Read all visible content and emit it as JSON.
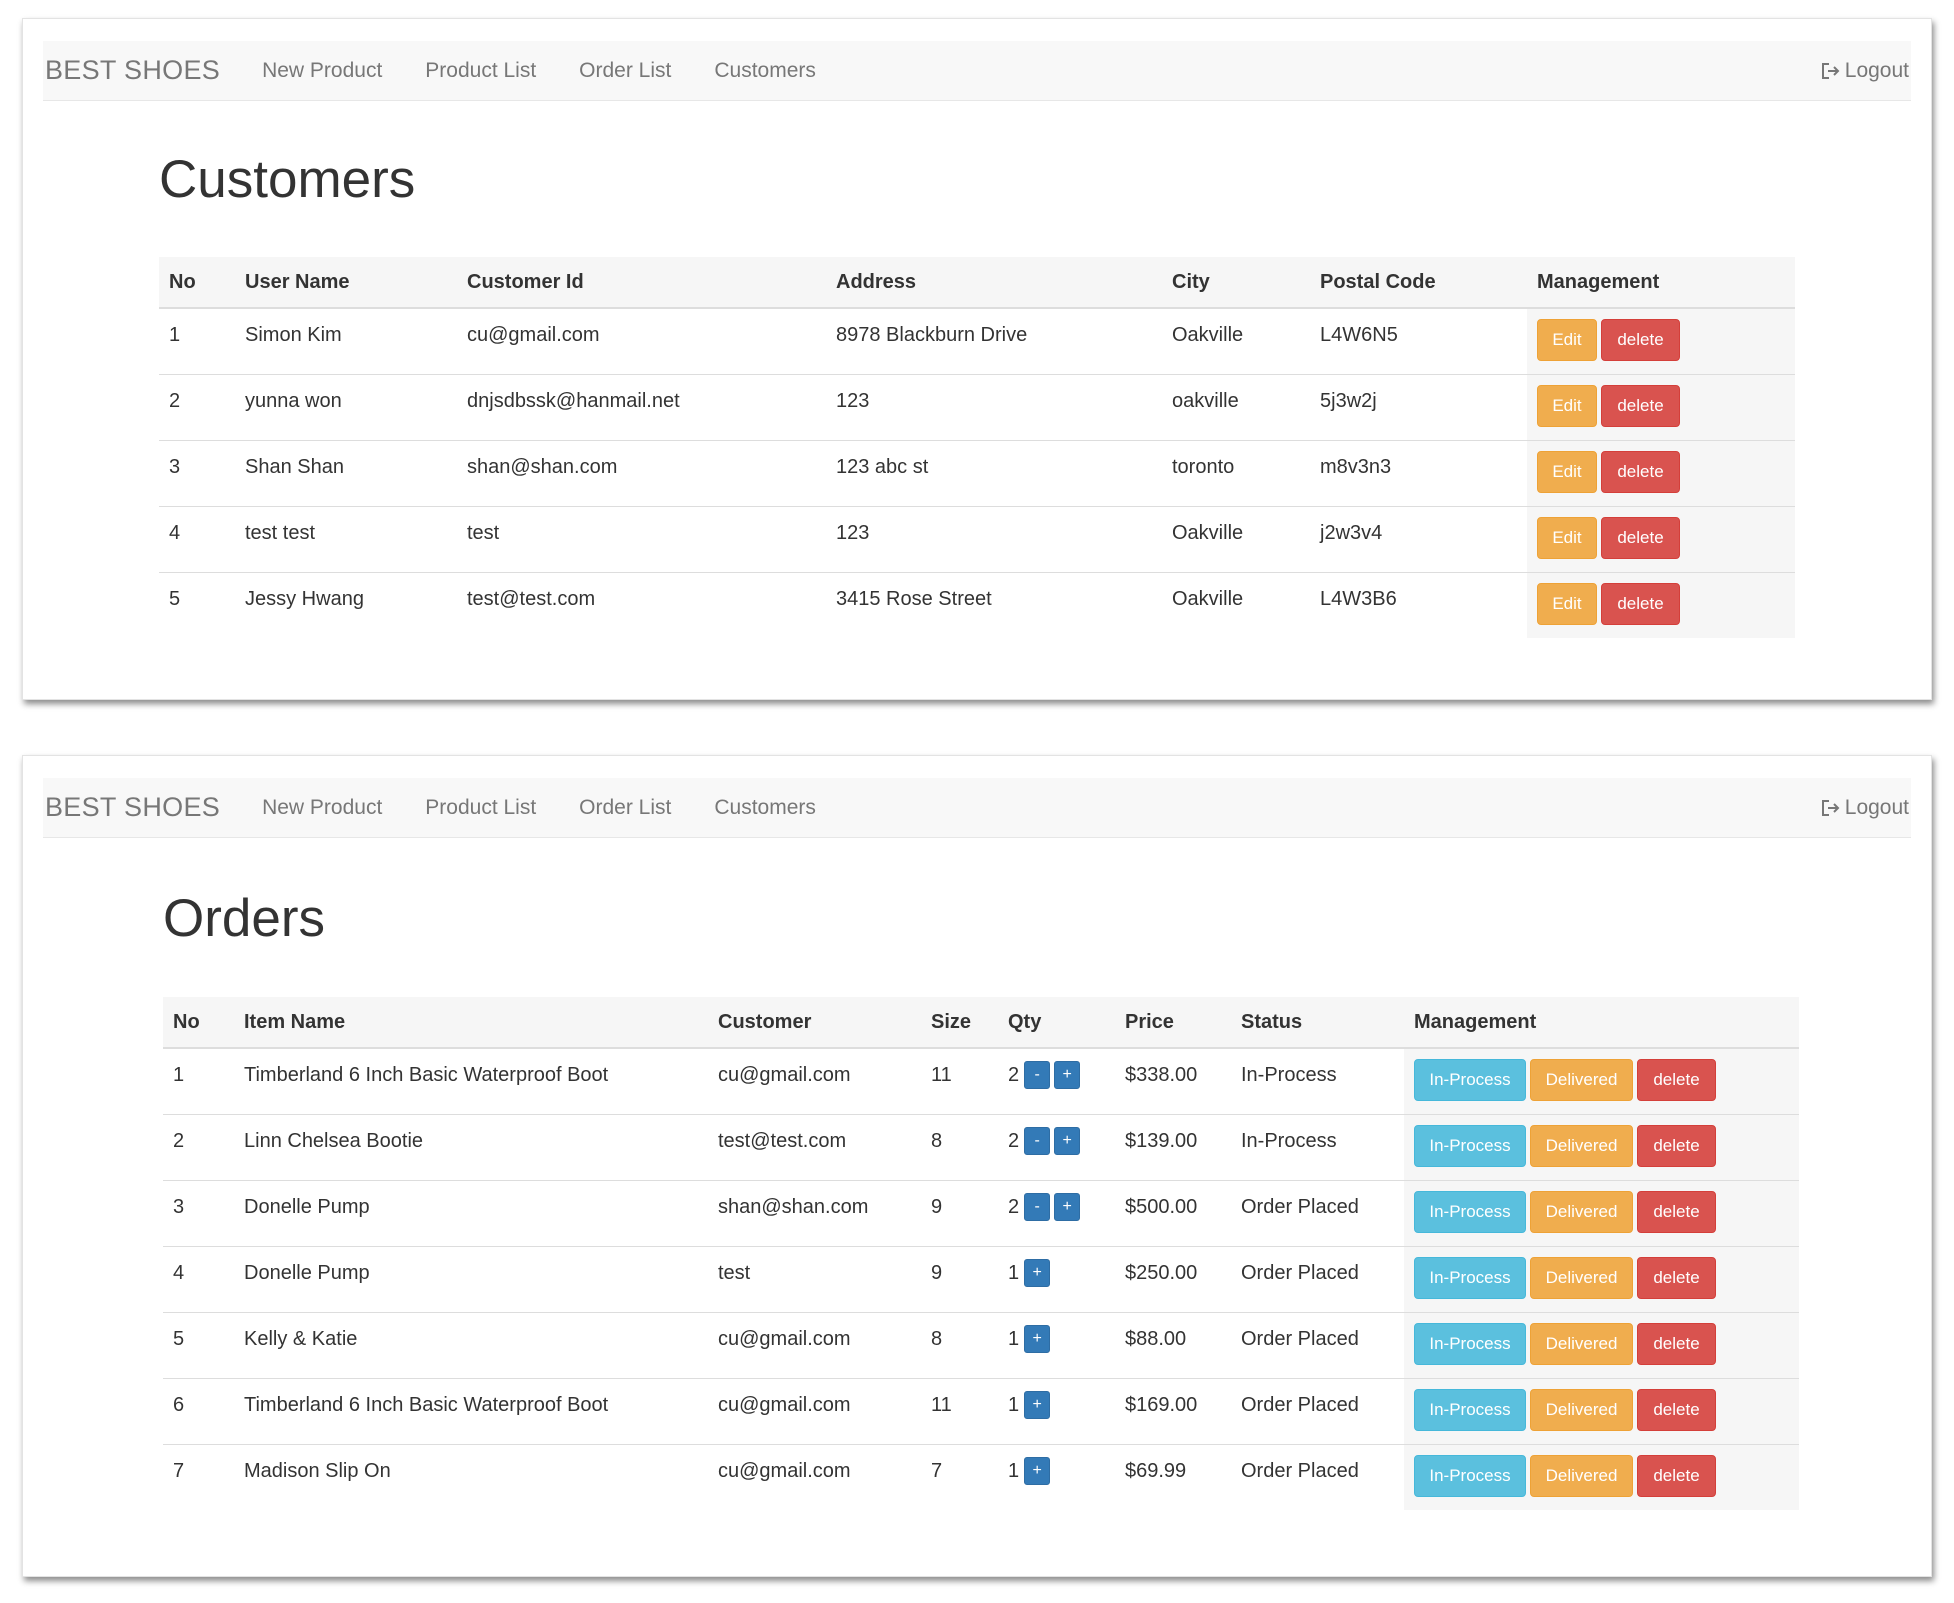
{
  "nav": {
    "brand": "BEST SHOES",
    "links": [
      "New Product",
      "Product List",
      "Order List",
      "Customers"
    ],
    "logout": "Logout"
  },
  "customers_page": {
    "title": "Customers",
    "headers": [
      "No",
      "User Name",
      "Customer Id",
      "Address",
      "City",
      "Postal Code",
      "Management"
    ],
    "rows": [
      {
        "no": "1",
        "user_name": "Simon Kim",
        "customer_id": "cu@gmail.com",
        "address": "8978 Blackburn Drive",
        "city": "Oakville",
        "postal": "L4W6N5"
      },
      {
        "no": "2",
        "user_name": "yunna won",
        "customer_id": "dnjsdbssk@hanmail.net",
        "address": "123",
        "city": "oakville",
        "postal": "5j3w2j"
      },
      {
        "no": "3",
        "user_name": "Shan Shan",
        "customer_id": "shan@shan.com",
        "address": "123 abc st",
        "city": "toronto",
        "postal": "m8v3n3"
      },
      {
        "no": "4",
        "user_name": "test test",
        "customer_id": "test",
        "address": "123",
        "city": "Oakville",
        "postal": "j2w3v4"
      },
      {
        "no": "5",
        "user_name": "Jessy Hwang",
        "customer_id": "test@test.com",
        "address": "3415 Rose Street",
        "city": "Oakville",
        "postal": "L4W3B6"
      }
    ],
    "edit_label": "Edit",
    "delete_label": "delete"
  },
  "orders_page": {
    "title": "Orders",
    "headers": [
      "No",
      "Item Name",
      "Customer",
      "Size",
      "Qty",
      "Price",
      "Status",
      "Management"
    ],
    "rows": [
      {
        "no": "1",
        "item": "Timberland 6 Inch Basic Waterproof Boot",
        "customer": "cu@gmail.com",
        "size": "11",
        "qty": "2",
        "price": "$338.00",
        "status": "In-Process",
        "has_minus": true
      },
      {
        "no": "2",
        "item": "Linn Chelsea Bootie",
        "customer": "test@test.com",
        "size": "8",
        "qty": "2",
        "price": "$139.00",
        "status": "In-Process",
        "has_minus": true
      },
      {
        "no": "3",
        "item": "Donelle Pump",
        "customer": "shan@shan.com",
        "size": "9",
        "qty": "2",
        "price": "$500.00",
        "status": "Order Placed",
        "has_minus": true
      },
      {
        "no": "4",
        "item": "Donelle Pump",
        "customer": "test",
        "size": "9",
        "qty": "1",
        "price": "$250.00",
        "status": "Order Placed",
        "has_minus": false
      },
      {
        "no": "5",
        "item": "Kelly & Katie",
        "customer": "cu@gmail.com",
        "size": "8",
        "qty": "1",
        "price": "$88.00",
        "status": "Order Placed",
        "has_minus": false
      },
      {
        "no": "6",
        "item": "Timberland 6 Inch Basic Waterproof Boot",
        "customer": "cu@gmail.com",
        "size": "11",
        "qty": "1",
        "price": "$169.00",
        "status": "Order Placed",
        "has_minus": false
      },
      {
        "no": "7",
        "item": "Madison Slip On",
        "customer": "cu@gmail.com",
        "size": "7",
        "qty": "1",
        "price": "$69.99",
        "status": "Order Placed",
        "has_minus": false
      }
    ],
    "minus_label": "-",
    "plus_label": "+",
    "inprocess_label": "In-Process",
    "delivered_label": "Delivered",
    "delete_label": "delete"
  },
  "colors": {
    "warning": "#f0ad4e",
    "danger": "#d9534f",
    "info": "#5bc0de",
    "primary": "#337ab7"
  },
  "icons": {
    "logout": "logout-icon"
  }
}
